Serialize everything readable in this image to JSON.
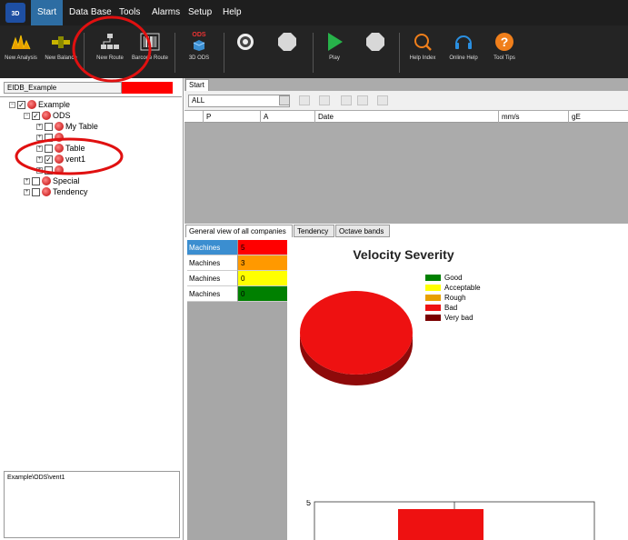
{
  "app": {
    "logo_text": "3D"
  },
  "menu": [
    "Start",
    "Data Base",
    "Tools",
    "Alarms",
    "Setup",
    "Help"
  ],
  "ribbon": {
    "new_analysis": "New Analysis",
    "new_balance": "New Balance",
    "new_route": "New Route",
    "barcode_route": "Barcode Route",
    "ods_badge": "ODS",
    "ods_3d": "3D ODS",
    "play": "Play",
    "help_index": "Help Index",
    "online_help": "Online Help",
    "tool_tips": "Tool Tips"
  },
  "left": {
    "db_name": "EIDB_Example",
    "tree": [
      {
        "label": "Example",
        "checked": true
      },
      {
        "label": "ODS",
        "checked": true
      },
      {
        "label": "My Table",
        "checked": false
      },
      {
        "label": "Table",
        "checked": false
      },
      {
        "label": "vent1",
        "checked": true
      },
      {
        "label": "Special",
        "checked": false
      },
      {
        "label": "Tendency",
        "checked": false
      }
    ],
    "path": "Example\\ODS\\vent1"
  },
  "right": {
    "tab": "Start",
    "filter_value": "ALL",
    "columns": [
      "P",
      "A",
      "Date",
      "mm/s",
      "gE"
    ],
    "lower_tabs": [
      "General view of all companies",
      "Tendency",
      "Octave bands"
    ],
    "machines": [
      {
        "label": "Machines",
        "value": "5",
        "color": "#ff0000"
      },
      {
        "label": "Machines",
        "value": "3",
        "color": "#ff9900"
      },
      {
        "label": "Machines",
        "value": "0",
        "color": "#ffff00"
      },
      {
        "label": "Machines",
        "value": "0",
        "color": "#008000"
      }
    ]
  },
  "chart_data": {
    "type": "pie",
    "title": "Velocity Severity",
    "legend": [
      {
        "name": "Good",
        "color": "#008000"
      },
      {
        "name": "Acceptable",
        "color": "#ffff00"
      },
      {
        "name": "Rough",
        "color": "#e8a000"
      },
      {
        "name": "Bad",
        "color": "#ee1111"
      },
      {
        "name": "Very bad",
        "color": "#7a0000"
      }
    ],
    "slices": [
      {
        "name": "Good",
        "value": 0
      },
      {
        "name": "Acceptable",
        "value": 0
      },
      {
        "name": "Rough",
        "value": 0
      },
      {
        "name": "Bad",
        "value": 5
      },
      {
        "name": "Very bad",
        "value": 0
      }
    ],
    "bar": {
      "value": 5,
      "ymax": 5,
      "tick_label": "5"
    }
  }
}
